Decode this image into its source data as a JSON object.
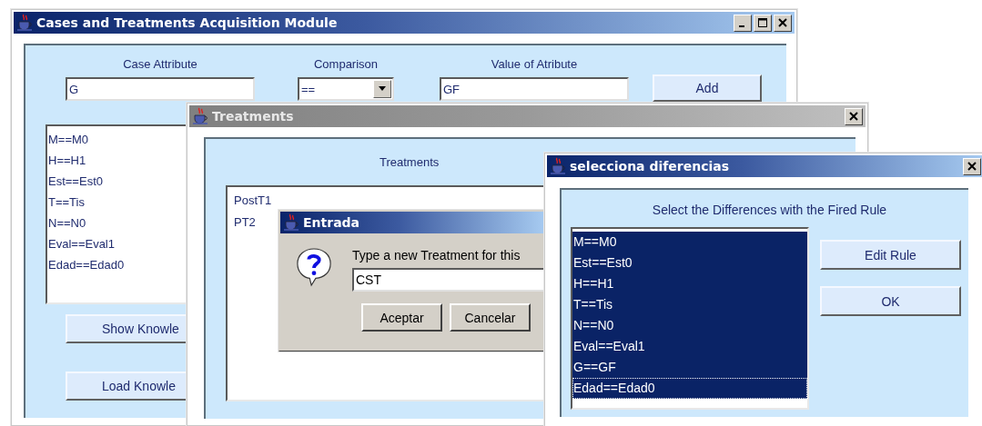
{
  "main_window": {
    "title": "Cases and Treatments Acquisition Module",
    "active": true,
    "labels": [
      "Case Attribute",
      "Comparison",
      "Value of Atribute"
    ],
    "attribute_field": {
      "value": "G"
    },
    "comparison_combo": {
      "value": "=="
    },
    "value_field": {
      "value": "GF"
    },
    "add_button": "Add",
    "conditions": [
      {
        "text": "M==M0",
        "selected": false
      },
      {
        "text": "H==H1",
        "selected": false
      },
      {
        "text": "Est==Est0",
        "selected": false
      },
      {
        "text": "T==Tis",
        "selected": false
      },
      {
        "text": "N==N0",
        "selected": false
      },
      {
        "text": "Eval==Eval1",
        "selected": false
      },
      {
        "text": "Edad==Edad0",
        "selected": false
      }
    ],
    "buttons": [
      "Show Knowle",
      "Load Knowle"
    ]
  },
  "treatments_window": {
    "title": "Treatments",
    "active": false,
    "heading": "Treatments",
    "treatments": [
      {
        "text": "PostT1",
        "selected": false
      },
      {
        "text": "PT2",
        "selected": false
      }
    ]
  },
  "input_dialog": {
    "title": "Entrada",
    "active": true,
    "message": "Type a new Treatment for this",
    "value": "CST",
    "buttons": [
      "Aceptar",
      "Cancelar"
    ]
  },
  "differences_window": {
    "title": "selecciona diferencias",
    "active": true,
    "heading": "Select the Differences with the Fired Rule",
    "items": [
      {
        "text": "M==M0",
        "selected": true,
        "focused": false
      },
      {
        "text": "Est==Est0",
        "selected": true,
        "focused": false
      },
      {
        "text": "H==H1",
        "selected": true,
        "focused": false
      },
      {
        "text": "T==Tis",
        "selected": true,
        "focused": false
      },
      {
        "text": "N==N0",
        "selected": true,
        "focused": false
      },
      {
        "text": "Eval==Eval1",
        "selected": true,
        "focused": false
      },
      {
        "text": "G==GF",
        "selected": true,
        "focused": false
      },
      {
        "text": "Edad==Edad0",
        "selected": true,
        "focused": true
      }
    ],
    "buttons": [
      "Edit Rule",
      "OK"
    ]
  }
}
